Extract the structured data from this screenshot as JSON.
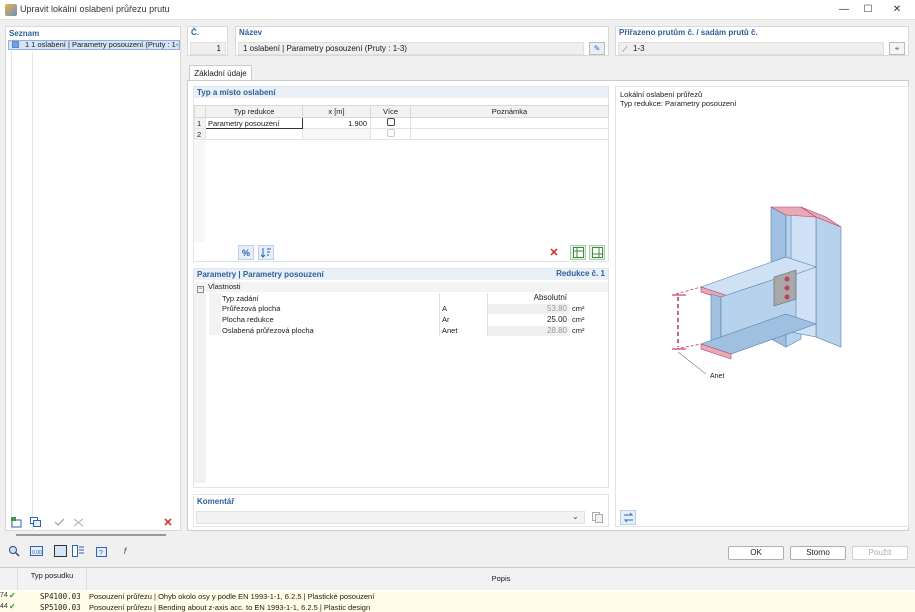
{
  "window": {
    "title": "Upravit lokální oslabení průřezu prutu",
    "minimize": "—",
    "maximize": "☐",
    "close": "✕"
  },
  "list": {
    "header": "Seznam",
    "items": [
      {
        "label": "1  1 oslabení | Parametry posouzení (Pruty : 1-3)"
      }
    ]
  },
  "header": {
    "no_label": "Č.",
    "no_value": "1",
    "name_label": "Název",
    "name_value": "1 oslabení | Parametry posouzení (Pruty : 1-3)",
    "assign_label": "Přiřazeno prutům č. / sadám prutů č.",
    "assign_value": "1-3"
  },
  "tabs": [
    {
      "label": "Základní údaje"
    }
  ],
  "reductions": {
    "header": "Typ a místo oslabení",
    "columns": [
      "Typ redukce",
      "x [m]",
      "Více",
      "Poznámka"
    ],
    "rows": [
      {
        "n": "1",
        "type": "Parametry posouzení",
        "x": "1.900",
        "more": false,
        "note": ""
      },
      {
        "n": "2",
        "type": "",
        "x": "",
        "more": false,
        "note": ""
      }
    ]
  },
  "params": {
    "header": "Parametry | Parametry posouzení",
    "header_right": "Redukce č. 1",
    "group": "Vlastnosti",
    "rows": [
      {
        "label": "Typ zadání",
        "symbol": "",
        "value": "Absolutní",
        "unit": ""
      },
      {
        "label": "Průřezová plocha",
        "symbol": "A",
        "value": "53.80",
        "unit": "cm²"
      },
      {
        "label": "Plocha redukce",
        "symbol": "Ar",
        "value": "25.00",
        "unit": "cm²"
      },
      {
        "label": "Oslabená průřezová plocha",
        "symbol": "Anet",
        "value": "28.80",
        "unit": "cm²"
      }
    ]
  },
  "comment": {
    "label": "Komentář",
    "value": ""
  },
  "preview": {
    "title": "Lokální oslabení průřezů",
    "subtitle": "Typ redukce: Parametry posouzení",
    "annotation": "Anet"
  },
  "buttons": {
    "ok": "OK",
    "cancel": "Storno",
    "apply": "Použít"
  },
  "footer": {
    "col_type": "Typ posudku",
    "col_desc": "Popis",
    "rows": [
      {
        "prefix": "74",
        "code": "SP4100.03",
        "desc": "Posouzení průřezu | Ohyb okolo osy y podle EN 1993-1-1, 6.2.5 | Plastické posouzení"
      },
      {
        "prefix": "44",
        "code": "SP5100.03",
        "desc": "Posouzení průřezu | Bending about z-axis acc. to EN 1993-1-1, 6.2.5 | Plastic design"
      }
    ]
  }
}
